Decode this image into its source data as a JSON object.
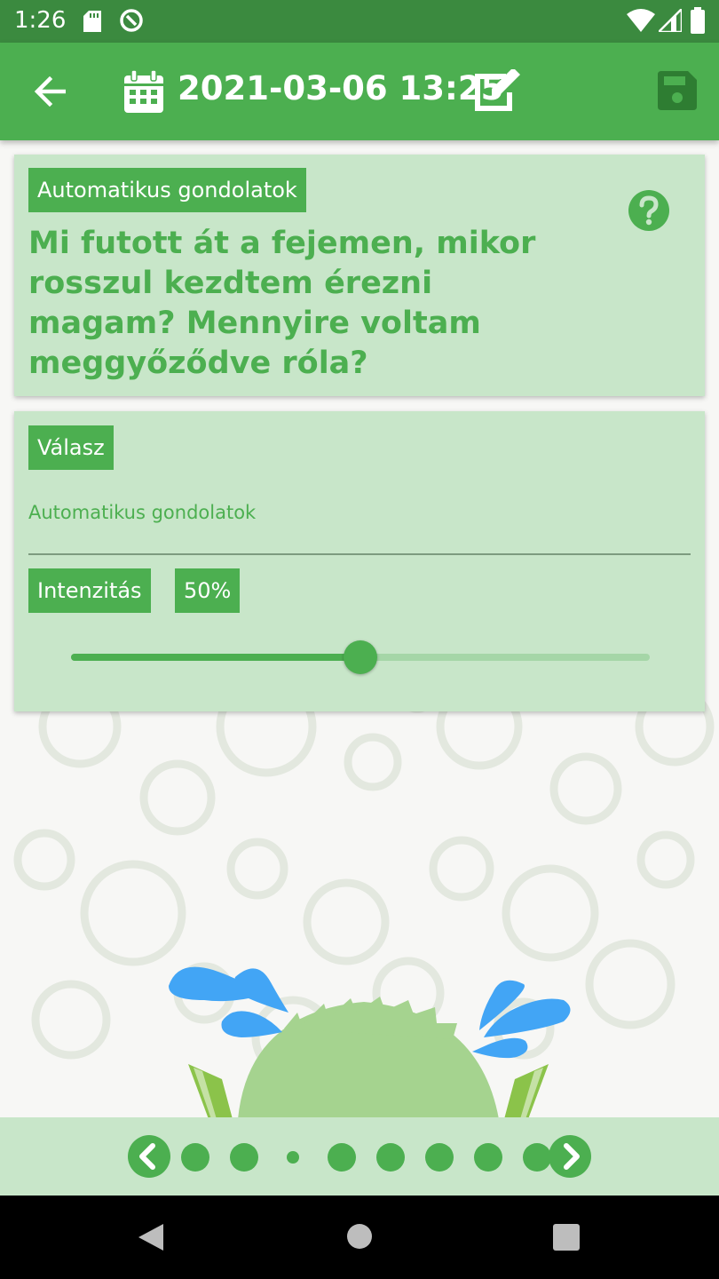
{
  "status_bar": {
    "time": "1:26"
  },
  "header": {
    "title": "2021-03-06 13:25"
  },
  "question_card": {
    "tag": "Automatikus gondolatok",
    "question": "Mi futott át a fejemen, mikor rosszul kezdtem érezni magam? Mennyire voltam meggyőződve róla?"
  },
  "answer_card": {
    "tag": "Válasz",
    "answer_value": "Automatikus gondolatok",
    "intensity_label": "Intenzitás",
    "intensity_value": "50%",
    "intensity_fraction": 0.5
  },
  "pager": {
    "page_count": 8,
    "current_index": 2
  },
  "icons": [
    "back-arrow-icon",
    "calendar-icon",
    "edit-icon",
    "save-icon",
    "help-icon",
    "chevron-left-icon",
    "chevron-right-icon"
  ],
  "colors": {
    "primary": "#4caf50",
    "primary_dark": "#3b8a3f",
    "card": "#c8e6c9",
    "track": "#a5d6a7"
  }
}
